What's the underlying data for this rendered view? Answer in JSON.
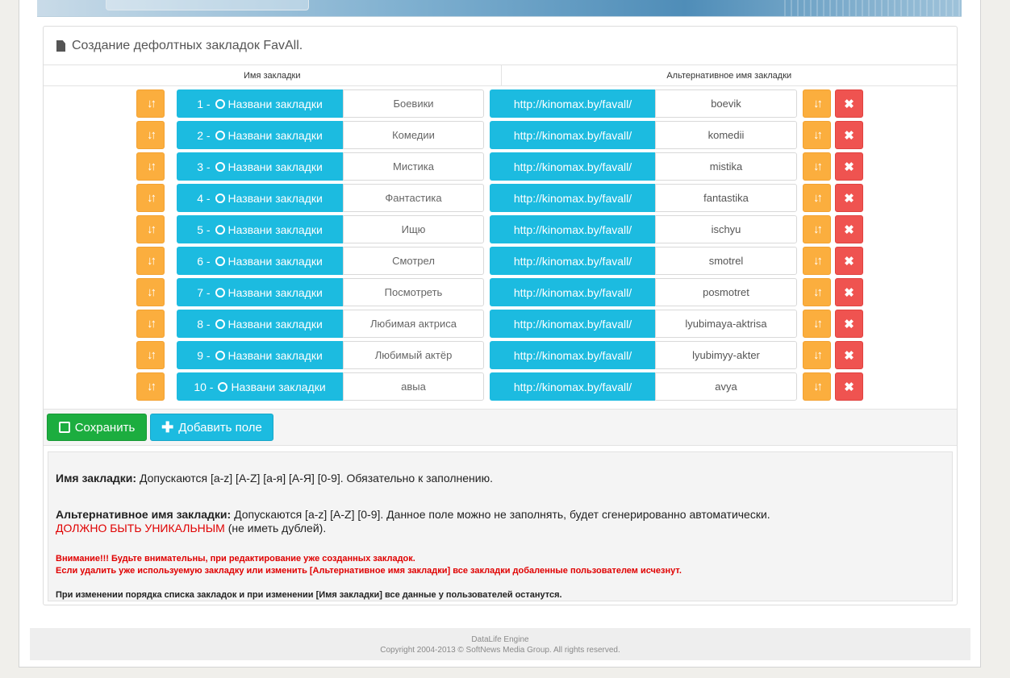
{
  "panel": {
    "title": "Создание дефолтных закладок FavAll."
  },
  "table": {
    "col_name": "Имя закладки",
    "col_alt": "Альтернативное имя закладки",
    "rows": [
      {
        "num": "1 -",
        "name_label": "Названи закладки",
        "name": "Боевики",
        "url": "http://kinomax.by/favall/",
        "alt": "boevik"
      },
      {
        "num": "2 -",
        "name_label": "Названи закладки",
        "name": "Комедии",
        "url": "http://kinomax.by/favall/",
        "alt": "komedii"
      },
      {
        "num": "3 -",
        "name_label": "Названи закладки",
        "name": "Мистика",
        "url": "http://kinomax.by/favall/",
        "alt": "mistika"
      },
      {
        "num": "4 -",
        "name_label": "Названи закладки",
        "name": "Фантастика",
        "url": "http://kinomax.by/favall/",
        "alt": "fantastika"
      },
      {
        "num": "5 -",
        "name_label": "Названи закладки",
        "name": "Ищю",
        "url": "http://kinomax.by/favall/",
        "alt": "ischyu"
      },
      {
        "num": "6 -",
        "name_label": "Названи закладки",
        "name": "Смотрел",
        "url": "http://kinomax.by/favall/",
        "alt": "smotrel"
      },
      {
        "num": "7 -",
        "name_label": "Названи закладки",
        "name": "Посмотреть",
        "url": "http://kinomax.by/favall/",
        "alt": "posmotret"
      },
      {
        "num": "8 -",
        "name_label": "Названи закладки",
        "name": "Любимая актриса",
        "url": "http://kinomax.by/favall/",
        "alt": "lyubimaya-aktrisa"
      },
      {
        "num": "9 -",
        "name_label": "Названи закладки",
        "name": "Любимый актёр",
        "url": "http://kinomax.by/favall/",
        "alt": "lyubimyy-akter"
      },
      {
        "num": "10 -",
        "name_label": "Названи закладки",
        "name": "авыа",
        "url": "http://kinomax.by/favall/",
        "alt": "avya"
      }
    ]
  },
  "toolbar": {
    "save_label": "Сохранить",
    "add_label": "Добавить поле"
  },
  "info": {
    "name_title": "Имя закладки:",
    "name_text": "Допускаются [a-z] [A-Z] [а-я] [А-Я] [0-9]. Обязательно к заполнению.",
    "alt_title": "Альтернативное имя закладки:",
    "alt_text": "Допускаются [a-z] [A-Z] [0-9]. Данное поле можно не заполнять, будет сгенерированно автоматически.",
    "unique_warn": "ДОЛЖНО БЫТЬ УНИКАЛЬНЫМ",
    "unique_note": "(не иметь дублей).",
    "warn_line1": "Внимание!!! Будьте внимательны, при редактирование уже созданных закладок.",
    "warn_line2": "Если удалить уже используемую закладку или изменить [Альтернативное имя закладки] все закладки добаленные пользователем исчезнут.",
    "note_line": "При изменении порядка списка закладок и при изменении [Имя закладки] все данные у пользователей останутся."
  },
  "footer": {
    "line1": "DataLife Engine",
    "line2": "Copyright 2004-2013 © SoftNews Media Group. All rights reserved."
  },
  "colors": {
    "cyan": "#1cbbe0",
    "orange": "#fbae3e",
    "red": "#ef5350",
    "green": "#1cad3f"
  },
  "icons": {
    "sort": "sort-icon",
    "delete": "delete-icon",
    "clip": "paperclip-icon",
    "save": "save-icon",
    "plus": "plus-icon",
    "doc": "document-icon"
  }
}
